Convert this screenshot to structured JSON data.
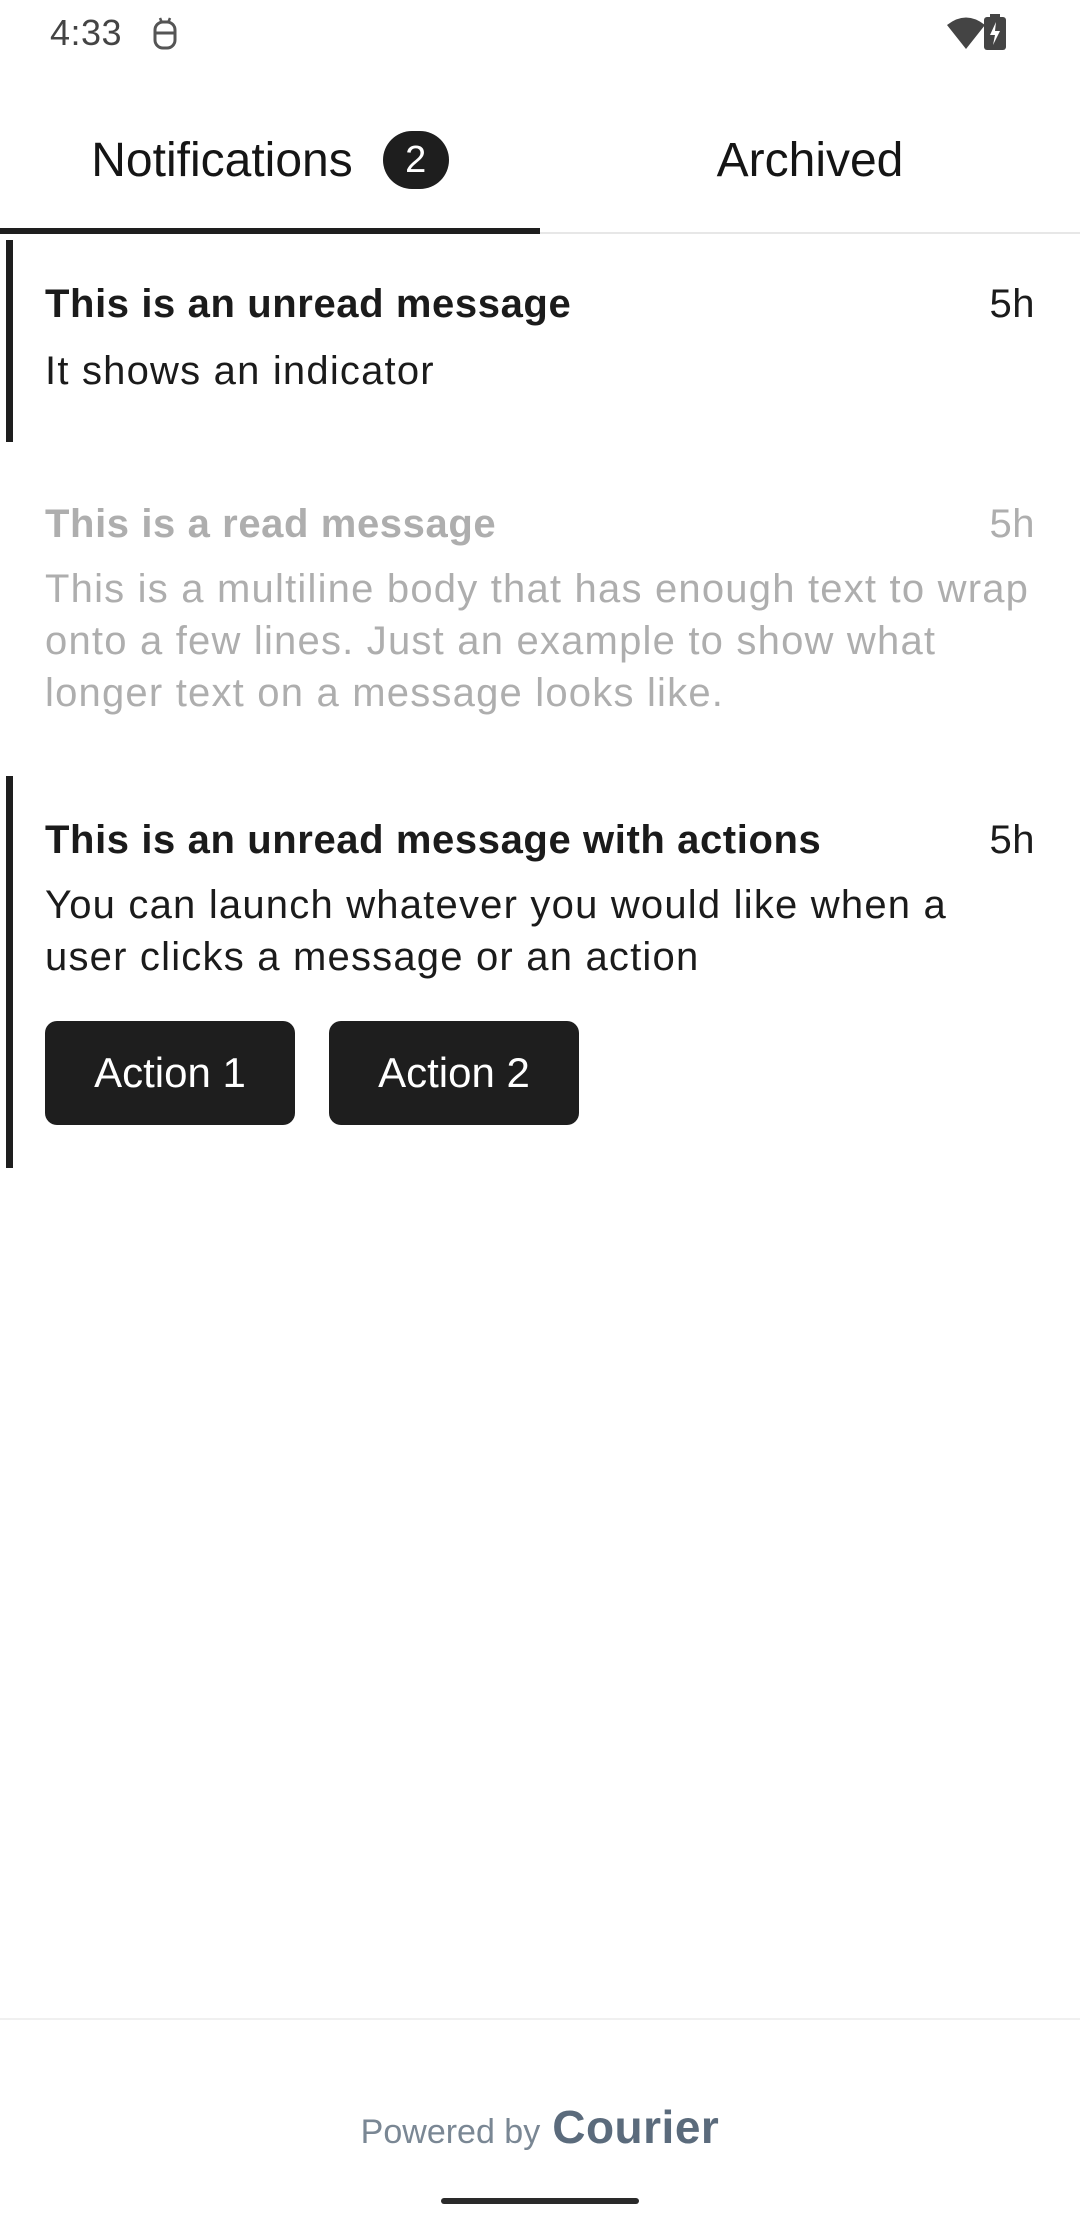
{
  "status_bar": {
    "time": "4:33",
    "icons": [
      "android-robot-icon",
      "wifi-icon",
      "battery-charging-icon"
    ]
  },
  "tabs": [
    {
      "label": "Notifications",
      "badge": "2",
      "selected": true
    },
    {
      "label": "Archived",
      "selected": false
    }
  ],
  "messages": [
    {
      "title": "This is an unread message",
      "time": "5h",
      "body": "It shows an indicator",
      "unread": true
    },
    {
      "title": "This is a read message",
      "time": "5h",
      "body": "This is a multiline body that has enough text to wrap onto a few lines. Just an example to show what longer text on a message looks like.",
      "unread": false
    },
    {
      "title": "This is an unread message with actions",
      "time": "5h",
      "body": "You can launch whatever you would like when a user clicks a message or an action",
      "unread": true,
      "actions": [
        "Action 1",
        "Action 2"
      ]
    }
  ],
  "footer": {
    "powered_by": "Powered by",
    "brand": "Courier"
  },
  "colors": {
    "accent": "#1e1e1e",
    "read_text": "#aeaeae",
    "brand": "#5b6b7c"
  }
}
